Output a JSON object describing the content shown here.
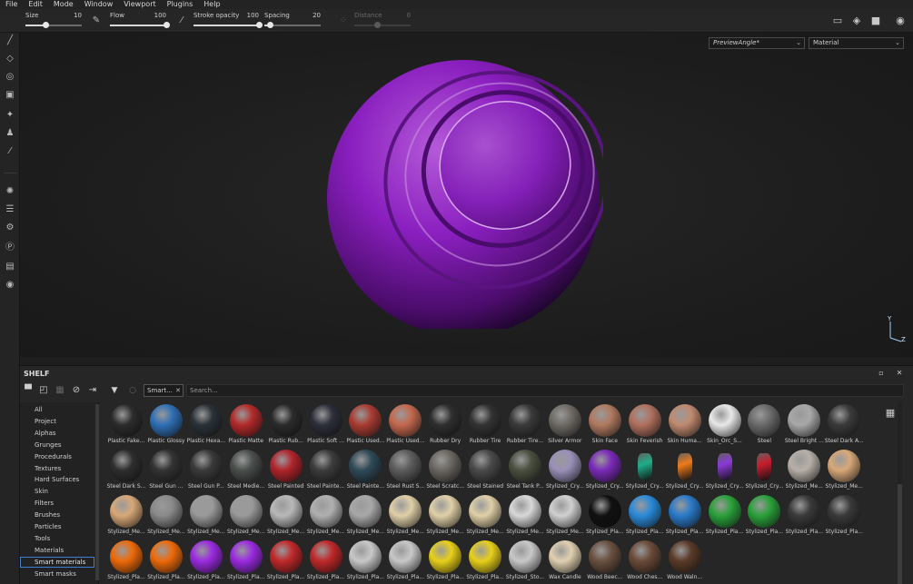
{
  "menu": [
    "File",
    "Edit",
    "Mode",
    "Window",
    "Viewport",
    "Plugins",
    "Help"
  ],
  "toolbar": {
    "size": {
      "label": "Size",
      "value": "10",
      "fraction": 0.35
    },
    "flow": {
      "label": "Flow",
      "value": "100",
      "fraction": 1.0
    },
    "stroke_opacity": {
      "label": "Stroke opacity",
      "value": "100",
      "fraction": 1.0
    },
    "spacing": {
      "label": "Spacing",
      "value": "20",
      "fraction": 0.1
    },
    "distance": {
      "label": "Distance",
      "value": "0",
      "fraction": 0.4
    }
  },
  "viewport": {
    "preview_select": "PreviewAngle*",
    "channel_select": "Material",
    "axis_y": "Y",
    "axis_z": "Z",
    "sphere_color": "#8a1fbf"
  },
  "shelf": {
    "title": "SHELF",
    "filter_chip": "Smart...",
    "search_placeholder": "Search...",
    "categories": [
      "All",
      "Project",
      "Alphas",
      "Grunges",
      "Procedurals",
      "Textures",
      "Hard Surfaces",
      "Skin",
      "Filters",
      "Brushes",
      "Particles",
      "Tools",
      "Materials",
      "Smart materials",
      "Smart masks"
    ],
    "active_category": "Smart materials",
    "selected_index": 80,
    "items": [
      {
        "name": "Plastic Fake...",
        "color": "#2c2c2c"
      },
      {
        "name": "Plastic Glossy",
        "color": "#2f6fb5"
      },
      {
        "name": "Plastic Hexa...",
        "color": "#2a3238"
      },
      {
        "name": "Plastic Matte",
        "color": "#b22a2a"
      },
      {
        "name": "Plastic Rub...",
        "color": "#2b2b2b"
      },
      {
        "name": "Plastic Soft ...",
        "color": "#2d2f3a"
      },
      {
        "name": "Plastic Used...",
        "color": "#a83c32"
      },
      {
        "name": "Plastic Used...",
        "color": "#c4684e"
      },
      {
        "name": "Rubber Dry",
        "color": "#2f2f2f"
      },
      {
        "name": "Rubber Tire",
        "color": "#333333"
      },
      {
        "name": "Rubber Tire...",
        "color": "#3a3a3a"
      },
      {
        "name": "Silver Armor",
        "color": "#6e6a64"
      },
      {
        "name": "Skin Face",
        "color": "#b07a60"
      },
      {
        "name": "Skin Feverish",
        "color": "#b0705e"
      },
      {
        "name": "Skin Huma...",
        "color": "#c08a70"
      },
      {
        "name": "Skin_Orc_S...",
        "color": "#e8e8e8"
      },
      {
        "name": "Steel",
        "color": "#6a6a6a"
      },
      {
        "name": "Steel Bright ...",
        "color": "#a8a8a8"
      },
      {
        "name": "Steel Dark A...",
        "color": "#3a3a3a"
      },
      {
        "name": "Steel Dark S...",
        "color": "#2e2e2e"
      },
      {
        "name": "Steel Gun ...",
        "color": "#333333"
      },
      {
        "name": "Steel Gun P...",
        "color": "#3a3a3a"
      },
      {
        "name": "Steel Medie...",
        "color": "#4a4f4c"
      },
      {
        "name": "Steel Painted",
        "color": "#b0242c"
      },
      {
        "name": "Steel Painte...",
        "color": "#3c3c3c"
      },
      {
        "name": "Steel Painte...",
        "color": "#2f4a58"
      },
      {
        "name": "Steel Rust S...",
        "color": "#5c5c5c"
      },
      {
        "name": "Steel Scratc...",
        "color": "#6a6660"
      },
      {
        "name": "Steel Stained",
        "color": "#4a4a4a"
      },
      {
        "name": "Steel Tank P...",
        "color": "#4a5040"
      },
      {
        "name": "Stylized_Cry...",
        "color": "#9a90b8"
      },
      {
        "name": "Stylized_Cry...",
        "color": "#7a2ab8"
      },
      {
        "name": "Stylized_Cry...",
        "color": "#1fae8a",
        "gem": true
      },
      {
        "name": "Stylized_Cry...",
        "color": "#ee7a1a",
        "gem": true
      },
      {
        "name": "Stylized_Cry...",
        "color": "#8a3ad8",
        "gem": true
      },
      {
        "name": "Stylized_Cry...",
        "color": "#c81c2c",
        "gem": true
      },
      {
        "name": "Stylized_Me...",
        "color": "#b8b0a8"
      },
      {
        "name": "Stylized_Me...",
        "color": "#d8a878"
      },
      {
        "name": "Stylized_Me...",
        "color": "#d8a878"
      },
      {
        "name": "Stylized_Me...",
        "color": "#8a8a8a"
      },
      {
        "name": "Stylized_Me...",
        "color": "#9a9a9a"
      },
      {
        "name": "Stylized_Me...",
        "color": "#9a9a9a"
      },
      {
        "name": "Stylized_Me...",
        "color": "#b8b8b8"
      },
      {
        "name": "Stylized_Me...",
        "color": "#b0b0b0"
      },
      {
        "name": "Stylized_Me...",
        "color": "#a8a8a8"
      },
      {
        "name": "Stylized_Me...",
        "color": "#e0d0a8"
      },
      {
        "name": "Stylized_Me...",
        "color": "#e0d0a8"
      },
      {
        "name": "Stylized_Me...",
        "color": "#e0d0a8"
      },
      {
        "name": "Stylized_Me...",
        "color": "#d8d8d8"
      },
      {
        "name": "Stylized_Me...",
        "color": "#d0d0d0"
      },
      {
        "name": "Stylized_Pla...",
        "color": "#111111"
      },
      {
        "name": "Stylized_Pla...",
        "color": "#2a8ad8"
      },
      {
        "name": "Stylized_Pla...",
        "color": "#2a7ac8"
      },
      {
        "name": "Stylized_Pla...",
        "color": "#2aa03a"
      },
      {
        "name": "Stylized_Pla...",
        "color": "#2aa03a"
      },
      {
        "name": "Stylized_Pla...",
        "color": "#3a3a3a"
      },
      {
        "name": "Stylized_Pla...",
        "color": "#3a3a3a"
      },
      {
        "name": "Stylized_Pla...",
        "color": "#ee6a0a"
      },
      {
        "name": "Stylized_Pla...",
        "color": "#ee6a0a"
      },
      {
        "name": "Stylized_Pla...",
        "color": "#9a2ae0"
      },
      {
        "name": "Stylized_Pla...",
        "color": "#9a2ae0"
      },
      {
        "name": "Stylized_Pla...",
        "color": "#c0282a"
      },
      {
        "name": "Stylized_Pla...",
        "color": "#c0282a"
      },
      {
        "name": "Stylized_Pla...",
        "color": "#c8c8c8"
      },
      {
        "name": "Stylized_Pla...",
        "color": "#c8c8c8"
      },
      {
        "name": "Stylized_Pla...",
        "color": "#e8d01a"
      },
      {
        "name": "Stylized_Pla...",
        "color": "#e8d01a"
      },
      {
        "name": "Stylized_Sto...",
        "color": "#c8c8c8"
      },
      {
        "name": "Wax Candle",
        "color": "#e0d0b0"
      },
      {
        "name": "Wood Beec...",
        "color": "#6a5040"
      },
      {
        "name": "Wood Ches...",
        "color": "#6a4a38"
      },
      {
        "name": "Wood Waln...",
        "color": "#5a3a28"
      }
    ]
  }
}
